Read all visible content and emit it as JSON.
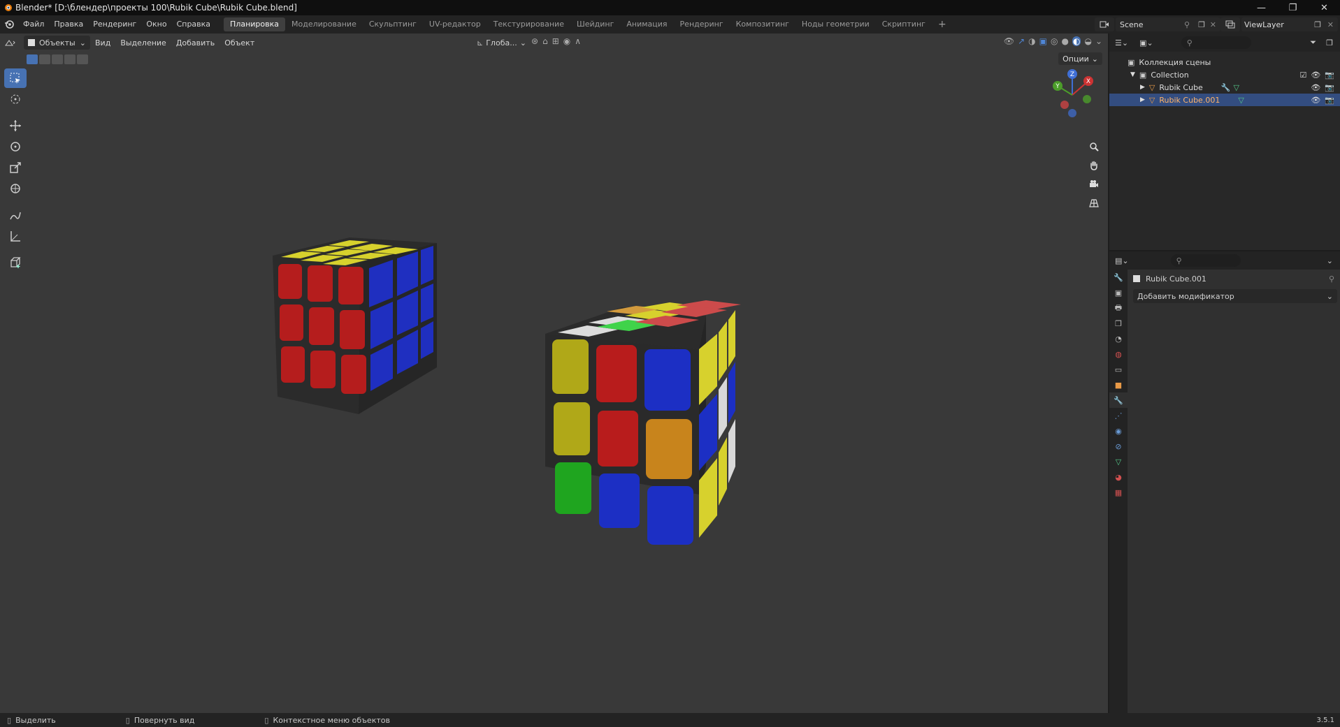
{
  "window": {
    "title": "Blender* [D:\\блендер\\проекты 100\\Rubik Cube\\Rubik Cube.blend]",
    "controls": [
      "—",
      "❐",
      "✕"
    ]
  },
  "menu": {
    "items": [
      "Файл",
      "Правка",
      "Рендеринг",
      "Окно",
      "Справка"
    ]
  },
  "workspaces": {
    "tabs": [
      "Планировка",
      "Моделирование",
      "Скульптинг",
      "UV-редактор",
      "Текстурирование",
      "Шейдинг",
      "Анимация",
      "Рендеринг",
      "Композитинг",
      "Ноды геометрии",
      "Скриптинг"
    ],
    "active": "Планировка",
    "add": "+"
  },
  "scene": {
    "name": "Scene",
    "view_layer": "ViewLayer"
  },
  "viewport_header": {
    "mode": "Объекты",
    "menus": [
      "Вид",
      "Выделение",
      "Добавить",
      "Объект"
    ],
    "transform_orientation": "Глоба...",
    "options": "Опции"
  },
  "outliner": {
    "root": "Коллекция сцены",
    "collection": "Collection",
    "objects": [
      {
        "name": "Rubik Cube",
        "selected": false
      },
      {
        "name": "Rubik Cube.001",
        "selected": true
      }
    ]
  },
  "properties": {
    "object_name": "Rubik Cube.001",
    "add_modifier": "Добавить модификатор"
  },
  "status": {
    "select": "Выделить",
    "rotate": "Повернуть вид",
    "context": "Контекстное меню объектов",
    "version": "3.5.1"
  },
  "gizmo": {
    "z": "Z",
    "y": "Y",
    "x": "X"
  },
  "colors": {
    "viewport_bg": "#393939",
    "accent": "#4772b3",
    "cube_red": "#b81c1c",
    "cube_yellow": "#d4d02a",
    "cube_blue": "#1c2fc4",
    "cube_green": "#1fa51f",
    "cube_white": "#d8d8d8",
    "cube_orange": "#c8841c"
  }
}
